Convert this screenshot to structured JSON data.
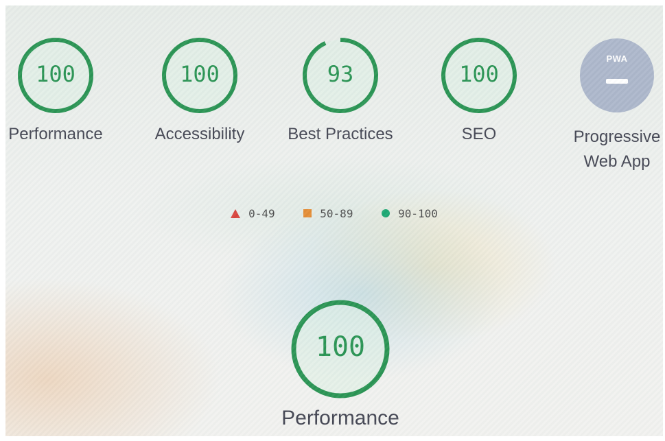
{
  "colors": {
    "pass": "#1e8e4a",
    "pass_fill": "#dbeee1",
    "average": "#e3872b",
    "fail": "#d63a32",
    "pwa_fill": "#a8b3c8"
  },
  "categories": [
    {
      "id": "performance",
      "score": 100,
      "label": "Performance"
    },
    {
      "id": "accessibility",
      "score": 100,
      "label": "Accessibility"
    },
    {
      "id": "best-practices",
      "score": 93,
      "label": "Best Practices"
    },
    {
      "id": "seo",
      "score": 100,
      "label": "SEO"
    }
  ],
  "pwa": {
    "badge": "PWA",
    "label_line1": "Progressive",
    "label_line2": "Web App",
    "icon": "pwa-dash-icon"
  },
  "legend": [
    {
      "icon": "triangle-icon",
      "range": "0-49"
    },
    {
      "icon": "square-icon",
      "range": "50-89"
    },
    {
      "icon": "circle-icon",
      "range": "90-100"
    }
  ],
  "featured": {
    "score": 100,
    "label": "Performance"
  }
}
